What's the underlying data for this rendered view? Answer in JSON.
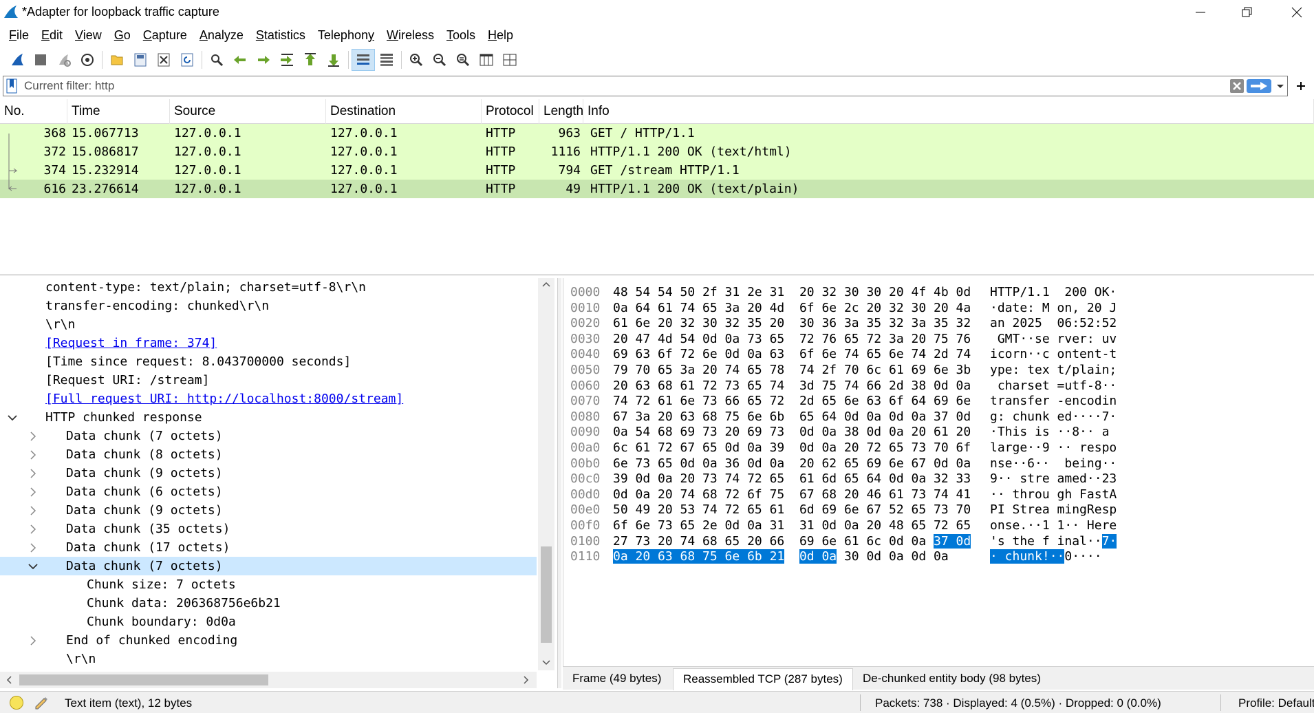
{
  "window": {
    "title": "*Adapter for loopback traffic capture"
  },
  "menu": [
    {
      "label": "File",
      "accel": "F",
      "rest": "ile"
    },
    {
      "label": "Edit",
      "accel": "E",
      "rest": "dit"
    },
    {
      "label": "View",
      "accel": "V",
      "rest": "iew"
    },
    {
      "label": "Go",
      "accel": "G",
      "rest": "o"
    },
    {
      "label": "Capture",
      "accel": "C",
      "rest": "apture"
    },
    {
      "label": "Analyze",
      "accel": "A",
      "rest": "nalyze"
    },
    {
      "label": "Statistics",
      "accel": "S",
      "rest": "tatistics"
    },
    {
      "label": "Telephony",
      "accel": "y",
      "rest": "Telephon"
    },
    {
      "label": "Wireless",
      "accel": "W",
      "rest": "ireless"
    },
    {
      "label": "Tools",
      "accel": "T",
      "rest": "ools"
    },
    {
      "label": "Help",
      "accel": "H",
      "rest": "elp"
    }
  ],
  "toolbar": [
    {
      "name": "start-capture-icon"
    },
    {
      "name": "stop-capture-icon"
    },
    {
      "name": "restart-capture-icon"
    },
    {
      "name": "capture-options-icon"
    },
    {
      "name": "open-file-icon"
    },
    {
      "name": "save-file-icon"
    },
    {
      "name": "close-file-icon"
    },
    {
      "name": "reload-file-icon"
    },
    {
      "name": "find-packet-icon"
    },
    {
      "name": "go-back-icon"
    },
    {
      "name": "go-forward-icon"
    },
    {
      "name": "go-to-packet-icon"
    },
    {
      "name": "go-first-packet-icon"
    },
    {
      "name": "go-last-packet-icon"
    },
    {
      "name": "autoscroll-icon"
    },
    {
      "name": "colorize-icon"
    },
    {
      "name": "zoom-in-icon"
    },
    {
      "name": "zoom-out-icon"
    },
    {
      "name": "zoom-normal-icon"
    },
    {
      "name": "resize-columns-icon"
    },
    {
      "name": "layout-icon"
    }
  ],
  "filter": {
    "placeholder": "Current filter: http"
  },
  "packet_list": {
    "columns": [
      "No.",
      "Time",
      "Source",
      "Destination",
      "Protocol",
      "Length",
      "Info"
    ],
    "rows": [
      {
        "no": "368",
        "time": "15.067713",
        "source": "127.0.0.1",
        "destination": "127.0.0.1",
        "protocol": "HTTP",
        "length": "963",
        "info": "GET / HTTP/1.1",
        "selected": false
      },
      {
        "no": "372",
        "time": "15.086817",
        "source": "127.0.0.1",
        "destination": "127.0.0.1",
        "protocol": "HTTP",
        "length": "1116",
        "info": "HTTP/1.1 200 OK  (text/html)",
        "selected": false
      },
      {
        "no": "374",
        "time": "15.232914",
        "source": "127.0.0.1",
        "destination": "127.0.0.1",
        "protocol": "HTTP",
        "length": "794",
        "info": "GET /stream HTTP/1.1",
        "selected": false
      },
      {
        "no": "616",
        "time": "23.276614",
        "source": "127.0.0.1",
        "destination": "127.0.0.1",
        "protocol": "HTTP",
        "length": "49",
        "info": "HTTP/1.1 200 OK  (text/plain)",
        "selected": true
      }
    ]
  },
  "details": [
    {
      "text": "content-type: text/plain; charset=utf-8\\r\\n",
      "indent": 1,
      "toggle": "",
      "link": false,
      "highlight": false
    },
    {
      "text": "transfer-encoding: chunked\\r\\n",
      "indent": 1,
      "toggle": "",
      "link": false,
      "highlight": false
    },
    {
      "text": "\\r\\n",
      "indent": 1,
      "toggle": "",
      "link": false,
      "highlight": false
    },
    {
      "text": "[Request in frame: 374]",
      "indent": 1,
      "toggle": "",
      "link": true,
      "highlight": false
    },
    {
      "text": "[Time since request: 8.043700000 seconds]",
      "indent": 1,
      "toggle": "",
      "link": false,
      "highlight": false
    },
    {
      "text": "[Request URI: /stream]",
      "indent": 1,
      "toggle": "",
      "link": false,
      "highlight": false
    },
    {
      "text": "[Full request URI: http://localhost:8000/stream]",
      "indent": 1,
      "toggle": "",
      "link": true,
      "highlight": false
    },
    {
      "text": "HTTP chunked response",
      "indent": 1,
      "toggle": "expanded",
      "link": false,
      "highlight": false
    },
    {
      "text": "Data chunk (7 octets)",
      "indent": 2,
      "toggle": "collapsed",
      "link": false,
      "highlight": false
    },
    {
      "text": "Data chunk (8 octets)",
      "indent": 2,
      "toggle": "collapsed",
      "link": false,
      "highlight": false
    },
    {
      "text": "Data chunk (9 octets)",
      "indent": 2,
      "toggle": "collapsed",
      "link": false,
      "highlight": false
    },
    {
      "text": "Data chunk (6 octets)",
      "indent": 2,
      "toggle": "collapsed",
      "link": false,
      "highlight": false
    },
    {
      "text": "Data chunk (9 octets)",
      "indent": 2,
      "toggle": "collapsed",
      "link": false,
      "highlight": false
    },
    {
      "text": "Data chunk (35 octets)",
      "indent": 2,
      "toggle": "collapsed",
      "link": false,
      "highlight": false
    },
    {
      "text": "Data chunk (17 octets)",
      "indent": 2,
      "toggle": "collapsed",
      "link": false,
      "highlight": false
    },
    {
      "text": "Data chunk (7 octets)",
      "indent": 2,
      "toggle": "expanded",
      "link": false,
      "highlight": true
    },
    {
      "text": "Chunk size: 7 octets",
      "indent": 3,
      "toggle": "",
      "link": false,
      "highlight": false
    },
    {
      "text": "Chunk data: 206368756e6b21",
      "indent": 3,
      "toggle": "",
      "link": false,
      "highlight": false
    },
    {
      "text": "Chunk boundary: 0d0a",
      "indent": 3,
      "toggle": "",
      "link": false,
      "highlight": false
    },
    {
      "text": "End of chunked encoding",
      "indent": 2,
      "toggle": "collapsed",
      "link": false,
      "highlight": false
    },
    {
      "text": "\\r\\n",
      "indent": 2,
      "toggle": "",
      "link": false,
      "highlight": false
    }
  ],
  "bytes": [
    {
      "offset": "0000",
      "hex_a": "48 54 54 50 2f 31 2e 31",
      "hex_b": "20 32 30 30 20 4f 4b 0d",
      "ascii_a": "HTTP/1.1",
      "ascii_b": " 200 OK·"
    },
    {
      "offset": "0010",
      "hex_a": "0a 64 61 74 65 3a 20 4d",
      "hex_b": "6f 6e 2c 20 32 30 20 4a",
      "ascii_a": "·date: M",
      "ascii_b": "on, 20 J"
    },
    {
      "offset": "0020",
      "hex_a": "61 6e 20 32 30 32 35 20",
      "hex_b": "30 36 3a 35 32 3a 35 32",
      "ascii_a": "an 2025 ",
      "ascii_b": "06:52:52"
    },
    {
      "offset": "0030",
      "hex_a": "20 47 4d 54 0d 0a 73 65",
      "hex_b": "72 76 65 72 3a 20 75 76",
      "ascii_a": " GMT··se",
      "ascii_b": "rver: uv"
    },
    {
      "offset": "0040",
      "hex_a": "69 63 6f 72 6e 0d 0a 63",
      "hex_b": "6f 6e 74 65 6e 74 2d 74",
      "ascii_a": "icorn··c",
      "ascii_b": "ontent-t"
    },
    {
      "offset": "0050",
      "hex_a": "79 70 65 3a 20 74 65 78",
      "hex_b": "74 2f 70 6c 61 69 6e 3b",
      "ascii_a": "ype: tex",
      "ascii_b": "t/plain;"
    },
    {
      "offset": "0060",
      "hex_a": "20 63 68 61 72 73 65 74",
      "hex_b": "3d 75 74 66 2d 38 0d 0a",
      "ascii_a": " charset",
      "ascii_b": "=utf-8··"
    },
    {
      "offset": "0070",
      "hex_a": "74 72 61 6e 73 66 65 72",
      "hex_b": "2d 65 6e 63 6f 64 69 6e",
      "ascii_a": "transfer",
      "ascii_b": "-encodin"
    },
    {
      "offset": "0080",
      "hex_a": "67 3a 20 63 68 75 6e 6b",
      "hex_b": "65 64 0d 0a 0d 0a 37 0d",
      "ascii_a": "g: chunk",
      "ascii_b": "ed····7·"
    },
    {
      "offset": "0090",
      "hex_a": "0a 54 68 69 73 20 69 73",
      "hex_b": "0d 0a 38 0d 0a 20 61 20",
      "ascii_a": "·This is",
      "ascii_b": "··8·· a "
    },
    {
      "offset": "00a0",
      "hex_a": "6c 61 72 67 65 0d 0a 39",
      "hex_b": "0d 0a 20 72 65 73 70 6f",
      "ascii_a": "large··9",
      "ascii_b": "·· respo"
    },
    {
      "offset": "00b0",
      "hex_a": "6e 73 65 0d 0a 36 0d 0a",
      "hex_b": "20 62 65 69 6e 67 0d 0a",
      "ascii_a": "nse··6··",
      "ascii_b": " being··"
    },
    {
      "offset": "00c0",
      "hex_a": "39 0d 0a 20 73 74 72 65",
      "hex_b": "61 6d 65 64 0d 0a 32 33",
      "ascii_a": "9·· stre",
      "ascii_b": "amed··23"
    },
    {
      "offset": "00d0",
      "hex_a": "0d 0a 20 74 68 72 6f 75",
      "hex_b": "67 68 20 46 61 73 74 41",
      "ascii_a": "·· throu",
      "ascii_b": "gh FastA"
    },
    {
      "offset": "00e0",
      "hex_a": "50 49 20 53 74 72 65 61",
      "hex_b": "6d 69 6e 67 52 65 73 70",
      "ascii_a": "PI Strea",
      "ascii_b": "mingResp"
    },
    {
      "offset": "00f0",
      "hex_a": "6f 6e 73 65 2e 0d 0a 31",
      "hex_b": "31 0d 0a 20 48 65 72 65",
      "ascii_a": "onse.··1",
      "ascii_b": "1·· Here"
    },
    {
      "offset": "0100",
      "hex_a": "27 73 20 74 68 65 20 66",
      "hex_b": "69 6e 61 6c 0d 0a ",
      "hex_sel_b": "37 0d",
      "ascii_a": "'s the f",
      "ascii_b": "inal··",
      "ascii_sel_b": "7·"
    },
    {
      "offset": "0110",
      "hex_sel_a": "0a 20 63 68 75 6e 6b 21",
      "hex_a": "",
      "hex_sel_b": "0d 0a",
      "hex_b": " 30 0d 0a 0d 0a",
      "ascii_sel_a": "· chunk!",
      "ascii_a": "",
      "ascii_sel_b": "··",
      "ascii_b": "0····"
    }
  ],
  "bytes_tabs": [
    {
      "label": "Frame (49 bytes)",
      "active": false
    },
    {
      "label": "Reassembled TCP (287 bytes)",
      "active": true
    },
    {
      "label": "De-chunked entity body (98 bytes)",
      "active": false
    }
  ],
  "status": {
    "text": "Text item (text), 12 bytes",
    "packets": "Packets: 738 · Displayed: 4 (0.5%) · Dropped: 0 (0.0%)",
    "profile": "Profile: Default"
  },
  "colors": {
    "http_row": "#e4ffc7",
    "selected_row": "#c8e6b0",
    "byte_selection": "#0078d7",
    "tree_highlight": "#cce8ff"
  }
}
